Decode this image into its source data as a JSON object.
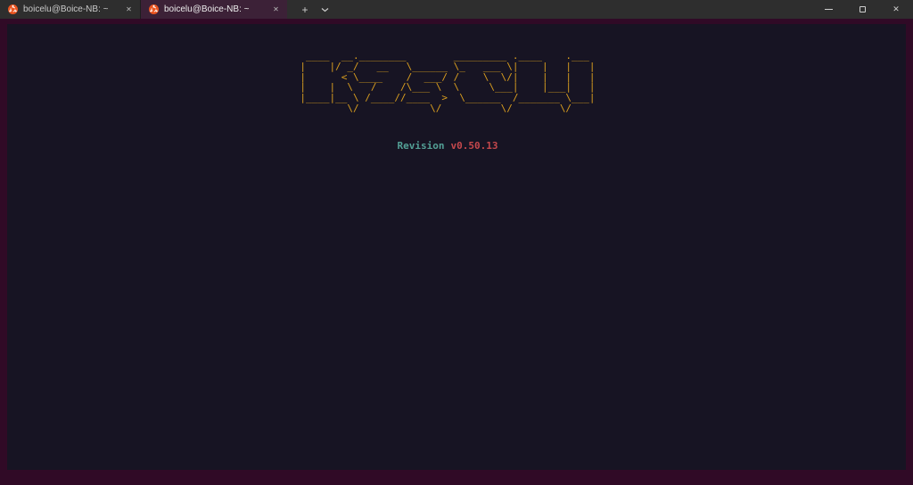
{
  "title_bar": {
    "tabs": [
      {
        "label": "boicelu@Boice-NB: ~",
        "active": false
      },
      {
        "label": "boicelu@Boice-NB: ~",
        "active": true
      }
    ]
  },
  "icons": {
    "ubuntu": "ubuntu-logo",
    "plus": "+",
    "close_tab": "✕",
    "close_window": "✕",
    "chevron_down": "chevron-down",
    "minimize": "minimize-dash",
    "maximize": "maximize-square"
  },
  "terminal": {
    "logo_lines": [
      " ____  __.________        _________ .____    .___ ",
      "|    |/ _/   __   \\______ \\_   ___ \\|    |   |   |",
      "|      < \\____    /  ___/ /    \\  \\/|    |   |   |",
      "|    |  \\   /    /\\___ \\  \\     \\___|    |___|   |",
      "|____|__ \\ /____//____  >  \\______  /_______ \\___|",
      "        \\/            \\/          \\/        \\/    "
    ],
    "revision_label": "Revision",
    "revision_value": "v0.50.13"
  },
  "colors": {
    "logo": "#d99e1f",
    "revision_label": "#53a096",
    "revision_value": "#c5484c",
    "terminal_background": "#171423",
    "window_frame": "#300a26",
    "title_bar": "#2e2e2e",
    "active_tab": "#3c2137",
    "ubuntu_orange": "#e95420"
  }
}
